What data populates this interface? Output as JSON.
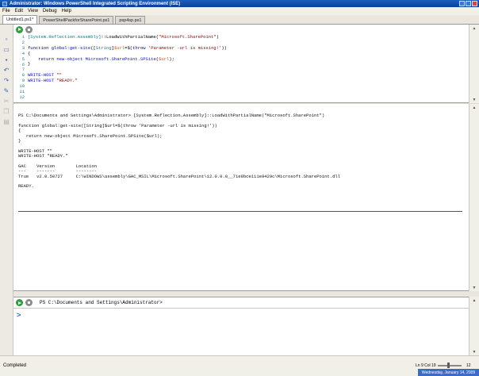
{
  "window": {
    "title": "Administrator: Windows PowerShell Integrated Scripting Environment (ISE)"
  },
  "menu": {
    "items": [
      "File",
      "Edit",
      "View",
      "Debug",
      "Help"
    ]
  },
  "tabs": [
    {
      "label": "Untitled1.ps1*",
      "active": true
    },
    {
      "label": "PowerShellPackforSharePoint.ps1",
      "active": false
    },
    {
      "label": "psp4sp.ps1",
      "active": false
    }
  ],
  "editor": {
    "line_numbers": [
      "1",
      "2",
      "3",
      "4",
      "5",
      "6",
      "7",
      "8",
      "9",
      "10",
      "11",
      "12"
    ],
    "lines": [
      [
        {
          "t": "[System.Reflection.Assembly]",
          "c": "c-type"
        },
        {
          "t": "::LoadWithPartialName(",
          "c": "c-plain"
        },
        {
          "t": "\"Microsoft.SharePoint\"",
          "c": "c-str"
        },
        {
          "t": ")",
          "c": "c-plain"
        }
      ],
      [],
      [
        {
          "t": "function ",
          "c": "c-kw"
        },
        {
          "t": "global:get-site",
          "c": "c-cmd"
        },
        {
          "t": "([",
          "c": "c-plain"
        },
        {
          "t": "String",
          "c": "c-type"
        },
        {
          "t": "]",
          "c": "c-plain"
        },
        {
          "t": "$url",
          "c": "c-var"
        },
        {
          "t": "=$(",
          "c": "c-plain"
        },
        {
          "t": "throw ",
          "c": "c-kw"
        },
        {
          "t": "'Parameter -url is missing!'",
          "c": "c-str"
        },
        {
          "t": "))",
          "c": "c-plain"
        }
      ],
      [
        {
          "t": "{",
          "c": "c-plain"
        }
      ],
      [
        {
          "t": "    ",
          "c": "c-plain"
        },
        {
          "t": "return ",
          "c": "c-kw"
        },
        {
          "t": "new-object ",
          "c": "c-cmd"
        },
        {
          "t": "Microsoft.SharePoint.SPSite",
          "c": "c-cmd"
        },
        {
          "t": "(",
          "c": "c-plain"
        },
        {
          "t": "$url",
          "c": "c-var"
        },
        {
          "t": ");",
          "c": "c-plain"
        }
      ],
      [
        {
          "t": "}",
          "c": "c-plain"
        }
      ],
      [],
      [
        {
          "t": "WRITE-HOST ",
          "c": "c-cmd"
        },
        {
          "t": "\"\"",
          "c": "c-str"
        }
      ],
      [
        {
          "t": "WRITE-HOST ",
          "c": "c-cmd"
        },
        {
          "t": "\"READY.\"",
          "c": "c-str"
        }
      ],
      [],
      [],
      []
    ]
  },
  "output": {
    "lines": [
      "PS C:\\Documents and Settings\\Administrator> [System.Reflection.Assembly]::LoadWithPartialName(\"Microsoft.SharePoint\")",
      "",
      "function global:get-site([String]$url=$(throw 'Parameter -url is missing!'))",
      "{",
      "   return new-object Microsoft.SharePoint.SPSite($url);",
      "}",
      "",
      "WRITE-HOST \"\"",
      "WRITE-HOST \"READY.\"",
      "",
      "GAC    Version        Location",
      "---    -------        --------",
      "True   v2.0.50727     C:\\WINDOWS\\assembly\\GAC_MSIL\\Microsoft.SharePoint\\12.0.0.0__71e9bce111e9429c\\Microsoft.SharePoint.dll",
      "",
      "READY."
    ]
  },
  "command_pane": {
    "prompt": "PS C:\\Documents and Settings\\Administrator>",
    "caret": ">"
  },
  "status": {
    "text": "Completed",
    "position": "Ln 9  Col 19",
    "zoom": "12",
    "datetime": "Wednesday, January 14, 2009"
  }
}
